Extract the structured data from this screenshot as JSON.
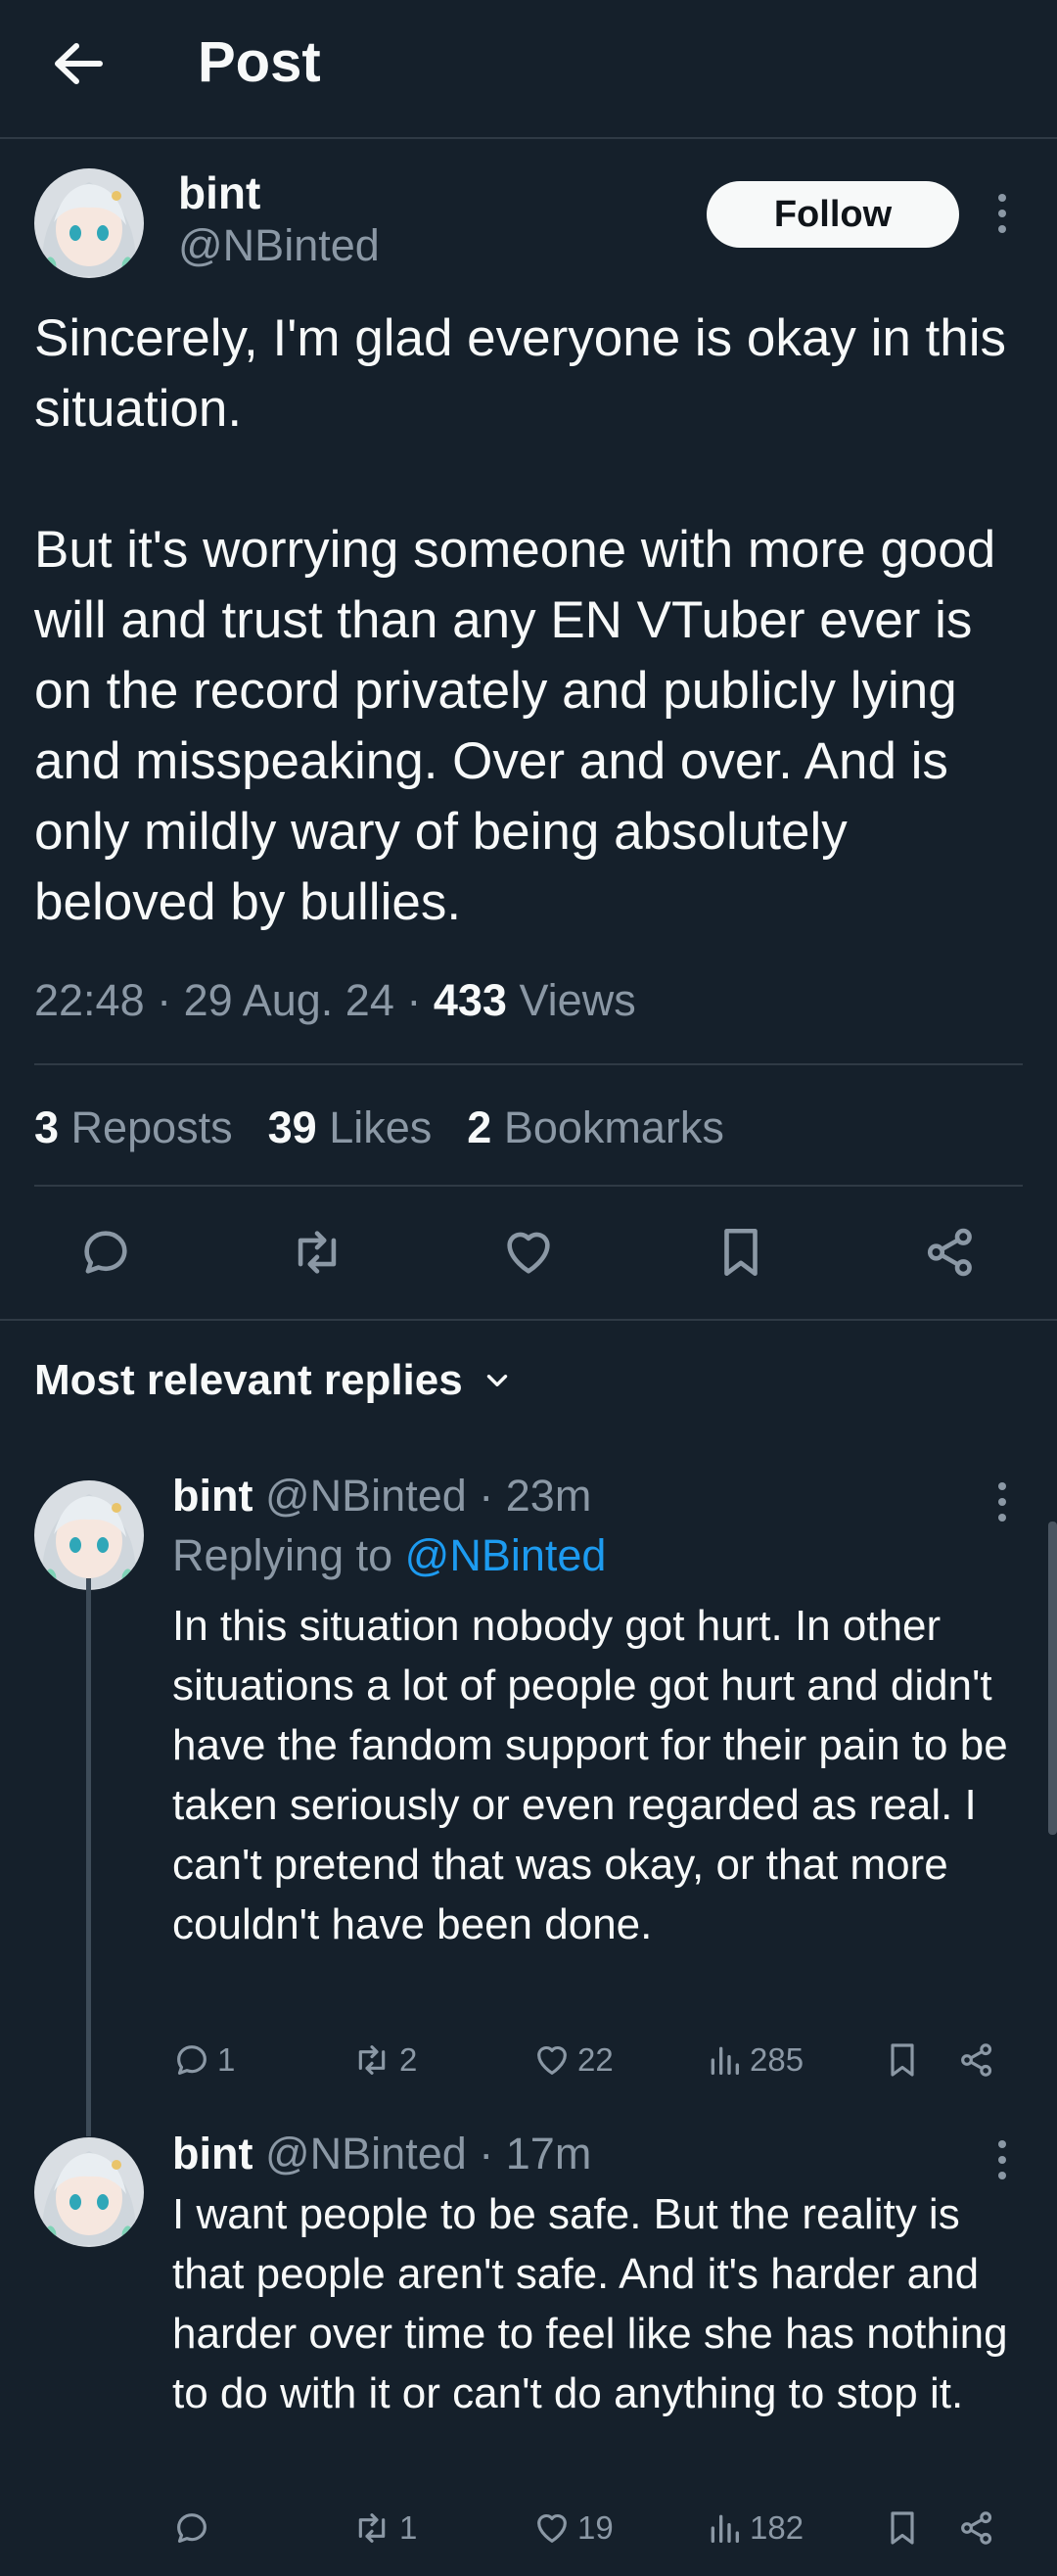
{
  "header": {
    "title": "Post"
  },
  "post": {
    "author_name": "bint",
    "author_handle": "@NBinted",
    "follow_label": "Follow",
    "text": "Sincerely, I'm glad everyone is okay in this situation.\n\nBut it's worrying someone with more good will and trust than any EN VTuber ever is on the record privately and publicly lying and misspeaking. Over and over. And is only mildly wary of being absolutely beloved by bullies.",
    "time": "22:48",
    "date": "29 Aug. 24",
    "views_count": "433",
    "views_label": "Views",
    "reposts_count": "3",
    "reposts_label": "Reposts",
    "likes_count": "39",
    "likes_label": "Likes",
    "bookmarks_count": "2",
    "bookmarks_label": "Bookmarks"
  },
  "replies_header": {
    "label": "Most relevant replies"
  },
  "replies": [
    {
      "author_name": "bint",
      "author_handle": "@NBinted",
      "time_ago": "23m",
      "replying_prefix": "Replying to",
      "replying_to": "@NBinted",
      "text": "In this situation nobody got hurt. In other situations a lot of people got hurt and didn't have the fandom support for their pain to be taken seriously or even regarded as real. I can't pretend that was okay, or that more couldn't have been done.",
      "comments": "1",
      "reposts": "2",
      "likes": "22",
      "views": "285"
    },
    {
      "author_name": "bint",
      "author_handle": "@NBinted",
      "time_ago": "17m",
      "text": "I want people to be safe. But the reality is that people aren't safe. And it's harder and harder over time to feel like she has nothing to do with it or can't do anything to stop it.",
      "comments": "",
      "reposts": "1",
      "likes": "19",
      "views": "182"
    }
  ],
  "colors": {
    "background": "#15202b",
    "text": "#e7e9ea",
    "muted": "#8b98a5",
    "link": "#1d9bf0",
    "divider": "#2f3a45"
  }
}
